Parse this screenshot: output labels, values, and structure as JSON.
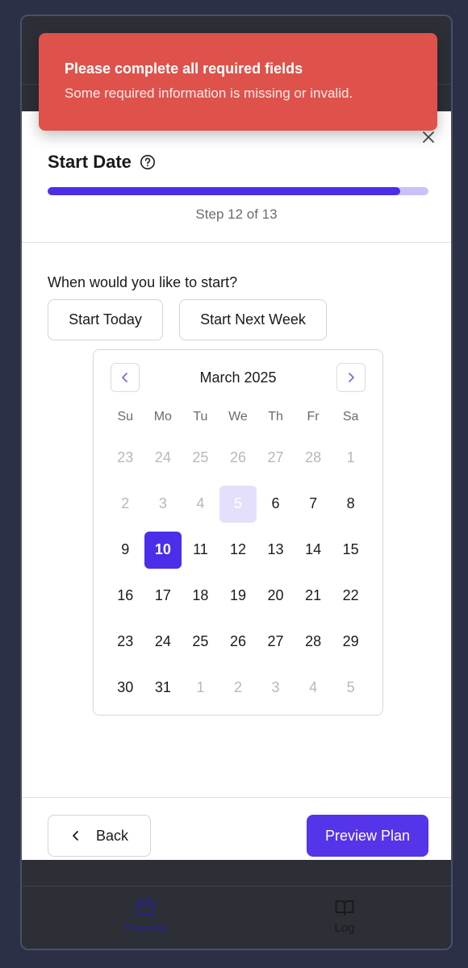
{
  "header": {
    "title": "Start Date",
    "step_counter": "Step 12 of 13",
    "progress": 0.925
  },
  "question": "When would you like to start?",
  "quick_options": {
    "start_today": "Start Today",
    "start_next_week": "Start Next Week"
  },
  "calendar": {
    "month_label": "March 2025",
    "weekdays": [
      "Su",
      "Mo",
      "Tu",
      "We",
      "Th",
      "Fr",
      "Sa"
    ],
    "days": [
      {
        "label": "23",
        "state": "muted"
      },
      {
        "label": "24",
        "state": "muted"
      },
      {
        "label": "25",
        "state": "muted"
      },
      {
        "label": "26",
        "state": "muted"
      },
      {
        "label": "27",
        "state": "muted"
      },
      {
        "label": "28",
        "state": "muted"
      },
      {
        "label": "1",
        "state": "muted"
      },
      {
        "label": "2",
        "state": "muted"
      },
      {
        "label": "3",
        "state": "muted"
      },
      {
        "label": "4",
        "state": "muted"
      },
      {
        "label": "5",
        "state": "today"
      },
      {
        "label": "6",
        "state": "normal"
      },
      {
        "label": "7",
        "state": "normal"
      },
      {
        "label": "8",
        "state": "normal"
      },
      {
        "label": "9",
        "state": "normal"
      },
      {
        "label": "10",
        "state": "selected"
      },
      {
        "label": "11",
        "state": "normal"
      },
      {
        "label": "12",
        "state": "normal"
      },
      {
        "label": "13",
        "state": "normal"
      },
      {
        "label": "14",
        "state": "normal"
      },
      {
        "label": "15",
        "state": "normal"
      },
      {
        "label": "16",
        "state": "normal"
      },
      {
        "label": "17",
        "state": "normal"
      },
      {
        "label": "18",
        "state": "normal"
      },
      {
        "label": "19",
        "state": "normal"
      },
      {
        "label": "20",
        "state": "normal"
      },
      {
        "label": "21",
        "state": "normal"
      },
      {
        "label": "22",
        "state": "normal"
      },
      {
        "label": "23",
        "state": "normal"
      },
      {
        "label": "24",
        "state": "normal"
      },
      {
        "label": "25",
        "state": "normal"
      },
      {
        "label": "26",
        "state": "normal"
      },
      {
        "label": "27",
        "state": "normal"
      },
      {
        "label": "28",
        "state": "normal"
      },
      {
        "label": "29",
        "state": "normal"
      },
      {
        "label": "30",
        "state": "normal"
      },
      {
        "label": "31",
        "state": "normal"
      },
      {
        "label": "1",
        "state": "muted"
      },
      {
        "label": "2",
        "state": "muted"
      },
      {
        "label": "3",
        "state": "muted"
      },
      {
        "label": "4",
        "state": "muted"
      },
      {
        "label": "5",
        "state": "muted"
      }
    ]
  },
  "footer": {
    "back_label": "Back",
    "preview_label": "Preview Plan"
  },
  "bottom_nav": {
    "training_label": "Training",
    "log_label": "Log"
  },
  "toast": {
    "title": "Please complete all required fields",
    "message": "Some required information is missing or invalid."
  },
  "colors": {
    "accent": "#4b2ee8",
    "toast_bg": "#df524b",
    "progress_track": "#c8c2f7",
    "today_bg": "#e4e0fb"
  },
  "icons": {
    "close": "close-icon",
    "help": "help-circle-icon",
    "prev": "chevron-left-icon",
    "next": "chevron-right-icon",
    "back": "chevron-left-icon",
    "training": "calendar-icon",
    "log": "book-open-icon"
  }
}
